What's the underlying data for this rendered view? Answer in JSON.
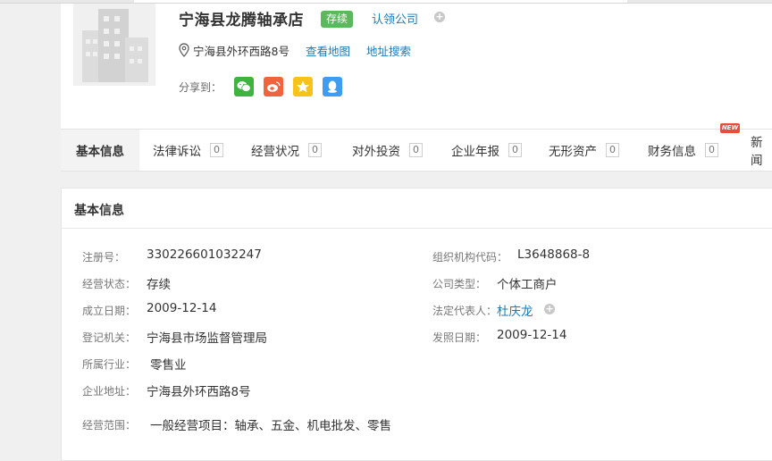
{
  "company": {
    "name": "宁海县龙腾轴承店",
    "status_badge": "存续",
    "claim_label": "认领公司",
    "address": "宁海县外环西路8号",
    "view_map_label": "查看地图",
    "address_search_label": "地址搜索",
    "share_label": "分享到：",
    "share_icons": [
      "wechat-icon",
      "weibo-icon",
      "qzone-icon",
      "qq-icon"
    ]
  },
  "colors": {
    "status_green": "#5cb85c",
    "link_blue": "#1b7ab6",
    "wechat": "#3fb33f",
    "weibo": "#f0633d",
    "qzone": "#f7c31b",
    "qq": "#3c9df2",
    "new_badge": "#e84c3d"
  },
  "tabs": [
    {
      "label": "基本信息",
      "count": ""
    },
    {
      "label": "法律诉讼",
      "count": "0"
    },
    {
      "label": "经营状况",
      "count": "0"
    },
    {
      "label": "对外投资",
      "count": "0"
    },
    {
      "label": "企业年报",
      "count": "0"
    },
    {
      "label": "无形资产",
      "count": "0"
    },
    {
      "label": "财务信息",
      "count": "0"
    },
    {
      "label": "新闻",
      "count": ""
    }
  ],
  "new_badge": "NEW",
  "panel": {
    "title": "基本信息",
    "fields": {
      "reg_no": {
        "label": "注册号：",
        "value": "330226601032247"
      },
      "org_code": {
        "label": "组织机构代码：",
        "value": "L3648868-8"
      },
      "biz_status": {
        "label": "经营状态：",
        "value": "存续"
      },
      "company_type": {
        "label": "公司类型：",
        "value": "个体工商户"
      },
      "founded": {
        "label": "成立日期：",
        "value": "2009-12-14"
      },
      "legal_rep": {
        "label": "法定代表人：",
        "value": "杜庆龙"
      },
      "reg_authority": {
        "label": "登记机关：",
        "value": "宁海县市场监督管理局"
      },
      "issue_date": {
        "label": "发照日期：",
        "value": "2009-12-14"
      },
      "industry": {
        "label": "所属行业：",
        "value": "零售业"
      },
      "address": {
        "label": "企业地址：",
        "value": "宁海县外环西路8号"
      },
      "scope": {
        "label": "经营范围：",
        "value": "一般经营项目：轴承、五金、机电批发、零售"
      }
    }
  }
}
